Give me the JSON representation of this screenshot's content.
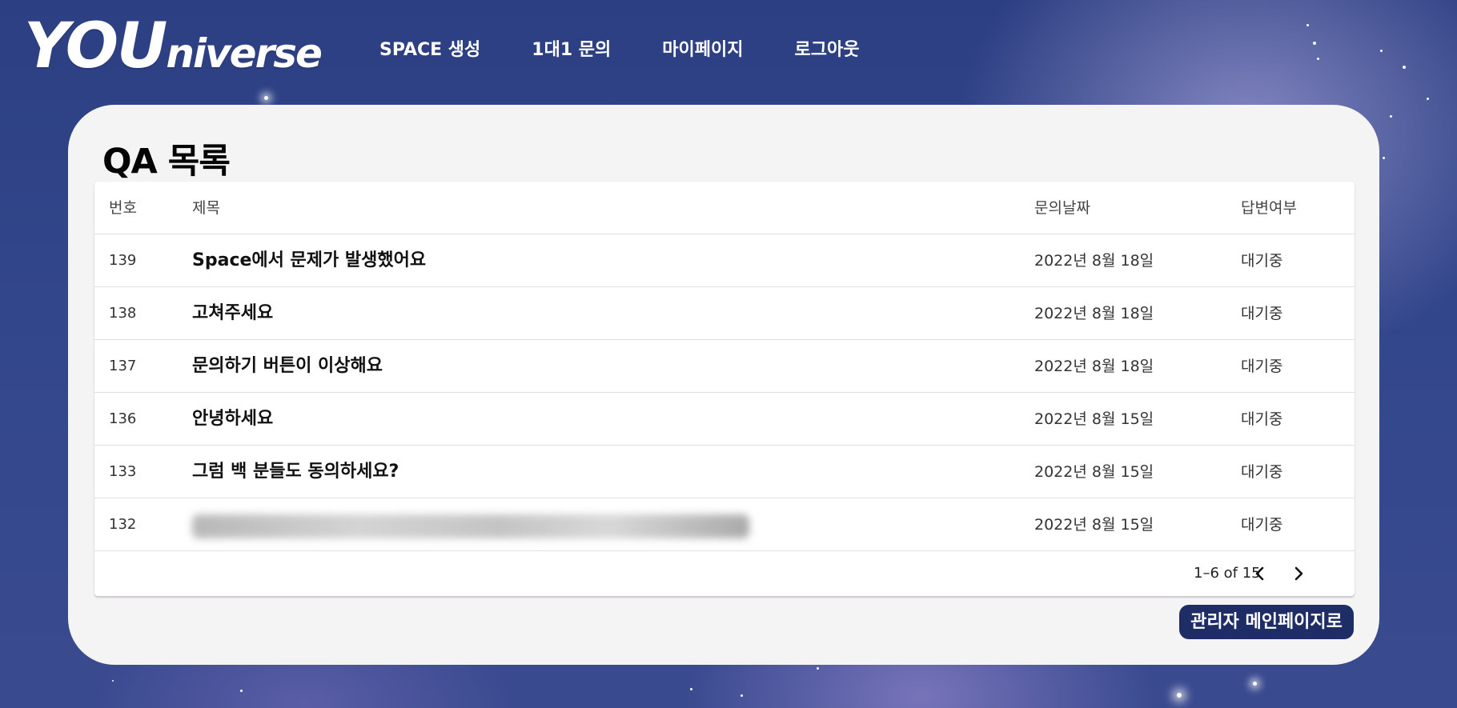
{
  "brand": {
    "logo_big": "YOU",
    "logo_small": "niverse"
  },
  "nav": [
    {
      "label": "SPACE 생성"
    },
    {
      "label": "1대1 문의"
    },
    {
      "label": "마이페이지"
    },
    {
      "label": "로그아웃"
    }
  ],
  "page": {
    "title": "QA 목록"
  },
  "table": {
    "columns": {
      "no": "번호",
      "title": "제목",
      "date": "문의날짜",
      "status": "답변여부"
    },
    "rows": [
      {
        "no": "139",
        "title": "Space에서 문제가 발생했어요",
        "date": "2022년 8월 18일",
        "status": "대기중"
      },
      {
        "no": "138",
        "title": "고쳐주세요",
        "date": "2022년 8월 18일",
        "status": "대기중"
      },
      {
        "no": "137",
        "title": "문의하기 버튼이 이상해요",
        "date": "2022년 8월 18일",
        "status": "대기중"
      },
      {
        "no": "136",
        "title": "안녕하세요",
        "date": "2022년 8월 15일",
        "status": "대기중"
      },
      {
        "no": "133",
        "title": "그럼 백 분들도 동의하세요?",
        "date": "2022년 8월 15일",
        "status": "대기중"
      },
      {
        "no": "132",
        "title": "",
        "date": "2022년 8월 15일",
        "status": "대기중"
      }
    ]
  },
  "pagination": {
    "range_text": "1–6 of 15"
  },
  "actions": {
    "admin_main": "관리자 메인페이지로"
  }
}
